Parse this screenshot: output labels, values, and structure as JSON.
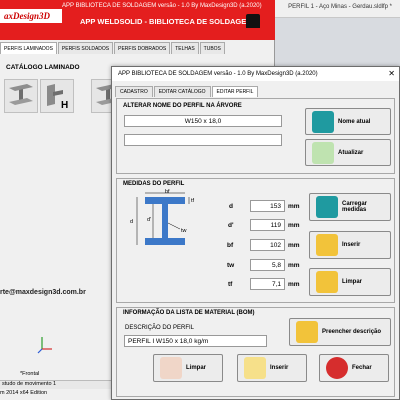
{
  "background": {
    "right_title": "PERFIL 1 - Aço Minas - Gerdau.sldlfp *"
  },
  "back_window": {
    "logo": "axDesign3D",
    "title": "APP BIBLIOTECA DE SOLDAGEM  versão - 1.0  By MaxDesign3D (a.2020)",
    "heading": "APP WELDSOLID - BIBLIOTECA DE SOLDAGEM",
    "tabs": [
      "PERFIS LAMINADOS",
      "PERFIS SOLDADOS",
      "PERFIS DOBRADOS",
      "TELHAS",
      "TUBOS"
    ],
    "catalog_label": "CATÁLOGO LAMINADO",
    "email": "rte@maxdesign3d.com.br",
    "frontal_label": "*Frontal",
    "status_text": "studo de movimento 1",
    "edition_text": "m 2014 x64 Edition"
  },
  "dialog": {
    "title": "APP BIBLIOTECA DE SOLDAGEM  versão - 1.0  By MaxDesign3D  (a.2020)",
    "close": "✕",
    "tabs": [
      "CADASTRO",
      "EDITAR CATÁLOGO",
      "EDITAR PERFIL"
    ],
    "rename_section": {
      "title": "ALTERAR NOME DO PERFIL NA ÁRVORE",
      "current_name": "W150 x 18,0",
      "new_name": "",
      "btn_current": "Nome atual",
      "btn_update": "Atualizar"
    },
    "dimensions_section": {
      "title": "MEDIDAS DO PERFIL",
      "drawing_labels": {
        "bf": "bf",
        "tf": "tf",
        "d": "d",
        "d_prime": "d'",
        "tw": "tw"
      },
      "fields": [
        {
          "label": "d",
          "value": "153",
          "unit": "mm"
        },
        {
          "label": "d'",
          "value": "119",
          "unit": "mm"
        },
        {
          "label": "bf",
          "value": "102",
          "unit": "mm"
        },
        {
          "label": "tw",
          "value": "5,8",
          "unit": "mm"
        },
        {
          "label": "tf",
          "value": "7,1",
          "unit": "mm"
        }
      ],
      "btn_load": "Carregar medidas",
      "btn_insert": "Inserir",
      "btn_clear": "Limpar"
    },
    "bom_section": {
      "title": "INFORMAÇÃO DA LISTA DE MATERIAL (BOM)",
      "desc_label": "DESCRIÇÃO DO PERFIL",
      "description": "PERFIL I W150 x 18,0 kg/m",
      "btn_fill": "Preencher descrição",
      "btn_clear": "Limpar",
      "btn_insert": "Inserir",
      "btn_close": "Fechar"
    }
  },
  "colors": {
    "titlebar_red": "#e41e1e",
    "dialog_bg": "#f0f0f0",
    "icon_teal": "#1f9aa0",
    "icon_green": "#bfe3b0",
    "icon_yellow": "#f2c33a",
    "icon_red": "#d62d2d"
  }
}
